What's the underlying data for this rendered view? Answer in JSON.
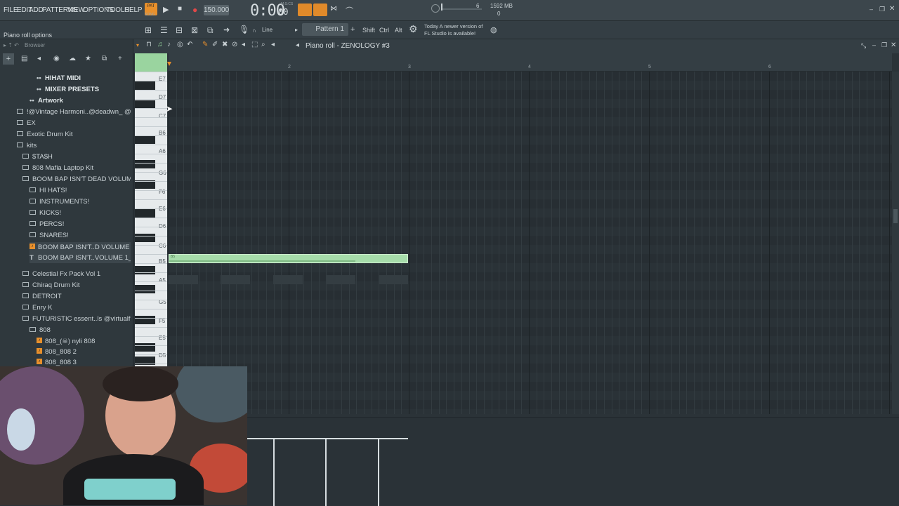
{
  "menu": [
    "FILE",
    "EDIT",
    "ADD",
    "PATTERNS",
    "VIEW",
    "OPTIONS",
    "TOOLS",
    "HELP"
  ],
  "transport": {
    "pat_label": "PAT",
    "song_label": "SONG",
    "tempo": "150.000",
    "time": "0:00",
    "time_small": "00",
    "time_unit": "M:S:CS"
  },
  "stats": {
    "cpu": "6",
    "memory": "1592 MB",
    "poly": "0"
  },
  "hint": "Piano roll options",
  "toolbar": {
    "snap_label": "Line",
    "pattern": "Pattern 1",
    "mod_keys": [
      "Shift",
      "Ctrl",
      "Alt"
    ],
    "news_line1": "Today  A newer version of",
    "news_line2": "FL Studio is available!"
  },
  "browser": {
    "title": "Browser",
    "items": [
      {
        "label": "HIHAT MIDI",
        "icon": "bullet",
        "level": 2,
        "bold": true
      },
      {
        "label": "MIXER PRESETS",
        "icon": "bullet",
        "level": 2,
        "bold": true
      },
      {
        "label": "Artwork",
        "icon": "bullet",
        "level": 1,
        "bold": true
      },
      {
        "label": "!@Vintage Harmoni..@deadwn_ @1mvnti",
        "icon": "folder",
        "level": 0
      },
      {
        "label": "EX",
        "icon": "folder",
        "level": 0
      },
      {
        "label": "Exotic Drum Kit",
        "icon": "folder",
        "level": 0
      },
      {
        "label": "kits",
        "icon": "folder",
        "level": 0
      },
      {
        "label": "$TA$H",
        "icon": "folder",
        "level": 1
      },
      {
        "label": "808 Mafia Laptop Kit",
        "icon": "folder",
        "level": 1
      },
      {
        "label": "BOOM BAP ISN'T DEAD VOLUME 1",
        "icon": "folder",
        "level": 1
      },
      {
        "label": "HI HATS!",
        "icon": "folder",
        "level": 2
      },
      {
        "label": "INSTRUMENTS!",
        "icon": "folder",
        "level": 2
      },
      {
        "label": "KICKS!",
        "icon": "folder",
        "level": 2
      },
      {
        "label": "PERCS!",
        "icon": "folder",
        "level": 2
      },
      {
        "label": "SNARES!",
        "icon": "folder",
        "level": 2
      },
      {
        "label": "BOOM BAP ISN'T..D VOLUME 1_DEMO",
        "icon": "file",
        "level": 2
      },
      {
        "label": "BOOM BAP ISN'T..VOLUME 1_README",
        "icon": "txt",
        "level": 2
      },
      {
        "label": "Celestial Fx Pack Vol 1",
        "icon": "folder",
        "level": 1
      },
      {
        "label": "Chiraq Drum Kit",
        "icon": "folder",
        "level": 1
      },
      {
        "label": "DETROIT",
        "icon": "folder",
        "level": 1
      },
      {
        "label": "Enry K",
        "icon": "folder",
        "level": 1
      },
      {
        "label": "FUTURISTIC essent..ls @virtualflavor",
        "icon": "folder",
        "level": 1
      },
      {
        "label": "808",
        "icon": "folder",
        "level": 2
      },
      {
        "label": "808_(☠) nyli 808",
        "icon": "file",
        "level": 3
      },
      {
        "label": "808_808 2",
        "icon": "file",
        "level": 3
      },
      {
        "label": "808_808 3",
        "icon": "file",
        "level": 3
      }
    ]
  },
  "piano_roll": {
    "title": "Piano roll - ZENOLOGY #3",
    "ruler": [
      "2",
      "3",
      "4",
      "5",
      "6"
    ],
    "keys": [
      "E7",
      "D7",
      "C7",
      "B6",
      "A6",
      "G6",
      "F6",
      "E6",
      "D6",
      "C6",
      "B5",
      "A5",
      "G5",
      "F5",
      "E5",
      "D5"
    ],
    "note_label": "B5",
    "note_color": "#a6dcaa"
  }
}
